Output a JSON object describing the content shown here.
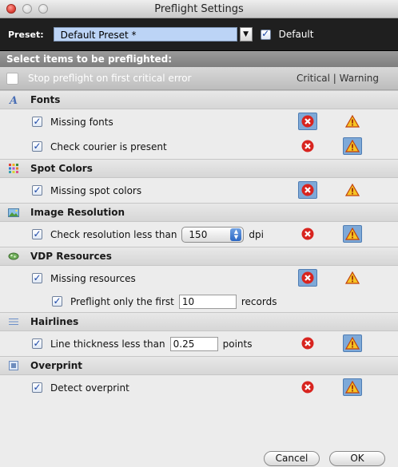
{
  "window": {
    "title": "Preflight Settings"
  },
  "preset": {
    "label": "Preset:",
    "value": "Default Preset *",
    "default_label": "Default",
    "default_checked": true
  },
  "select_header": "Select items to be preflighted:",
  "stop_option": {
    "label": "Stop preflight on first critical error",
    "checked": false
  },
  "columns": {
    "header": "Critical | Warning"
  },
  "sections": {
    "fonts": {
      "label": "Fonts",
      "rows": [
        {
          "label": "Missing fonts",
          "checked": true,
          "selected": "critical"
        },
        {
          "label": "Check courier is present",
          "checked": true,
          "selected": "warning"
        }
      ]
    },
    "spot_colors": {
      "label": "Spot Colors",
      "rows": [
        {
          "label": "Missing spot colors",
          "checked": true,
          "selected": "critical"
        }
      ]
    },
    "image_resolution": {
      "label": "Image Resolution",
      "row": {
        "label": "Check resolution less than",
        "value": "150",
        "unit": "dpi",
        "checked": true,
        "selected": "warning"
      }
    },
    "vdp_resources": {
      "label": "VDP Resources",
      "row": {
        "label": "Missing resources",
        "checked": true,
        "selected": "critical"
      },
      "subrow": {
        "label": "Preflight only the first",
        "value": "10",
        "unit": "records",
        "checked": true
      }
    },
    "hairlines": {
      "label": "Hairlines",
      "row": {
        "label": "Line thickness less than",
        "value": "0.25",
        "unit": "points",
        "checked": true,
        "selected": "warning"
      }
    },
    "overprint": {
      "label": "Overprint",
      "row": {
        "label": "Detect overprint",
        "checked": true,
        "selected": "warning"
      }
    }
  },
  "buttons": {
    "cancel": "Cancel",
    "ok": "OK"
  },
  "icons": {
    "critical": "error-icon",
    "warning": "warning-icon"
  },
  "colors": {
    "selected_bg": "#7ea9d8",
    "critical": "#d8241f",
    "warning": "#f6c323",
    "preset_bar": "#1f1f1f"
  }
}
